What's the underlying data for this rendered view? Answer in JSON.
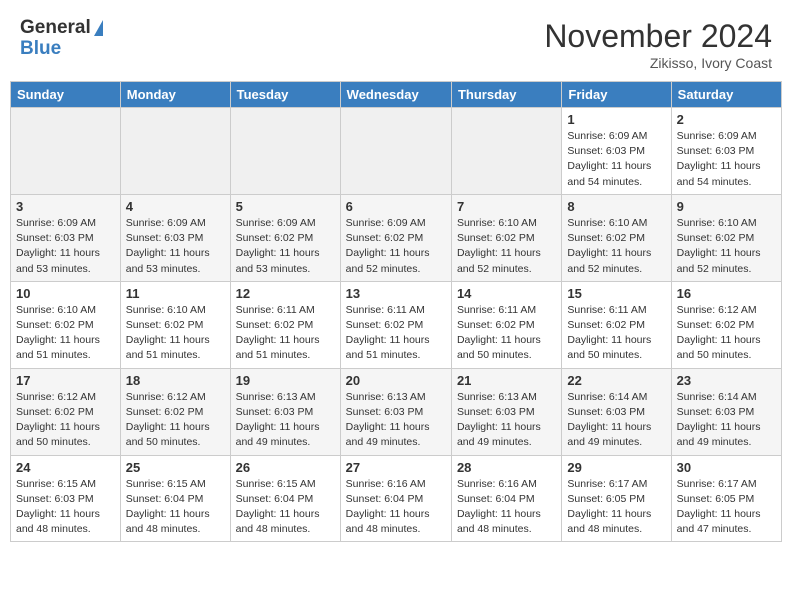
{
  "header": {
    "logo_general": "General",
    "logo_blue": "Blue",
    "month_title": "November 2024",
    "subtitle": "Zikisso, Ivory Coast"
  },
  "weekdays": [
    "Sunday",
    "Monday",
    "Tuesday",
    "Wednesday",
    "Thursday",
    "Friday",
    "Saturday"
  ],
  "weeks": [
    [
      {
        "day": "",
        "info": ""
      },
      {
        "day": "",
        "info": ""
      },
      {
        "day": "",
        "info": ""
      },
      {
        "day": "",
        "info": ""
      },
      {
        "day": "",
        "info": ""
      },
      {
        "day": "1",
        "info": "Sunrise: 6:09 AM\nSunset: 6:03 PM\nDaylight: 11 hours\nand 54 minutes."
      },
      {
        "day": "2",
        "info": "Sunrise: 6:09 AM\nSunset: 6:03 PM\nDaylight: 11 hours\nand 54 minutes."
      }
    ],
    [
      {
        "day": "3",
        "info": "Sunrise: 6:09 AM\nSunset: 6:03 PM\nDaylight: 11 hours\nand 53 minutes."
      },
      {
        "day": "4",
        "info": "Sunrise: 6:09 AM\nSunset: 6:03 PM\nDaylight: 11 hours\nand 53 minutes."
      },
      {
        "day": "5",
        "info": "Sunrise: 6:09 AM\nSunset: 6:02 PM\nDaylight: 11 hours\nand 53 minutes."
      },
      {
        "day": "6",
        "info": "Sunrise: 6:09 AM\nSunset: 6:02 PM\nDaylight: 11 hours\nand 52 minutes."
      },
      {
        "day": "7",
        "info": "Sunrise: 6:10 AM\nSunset: 6:02 PM\nDaylight: 11 hours\nand 52 minutes."
      },
      {
        "day": "8",
        "info": "Sunrise: 6:10 AM\nSunset: 6:02 PM\nDaylight: 11 hours\nand 52 minutes."
      },
      {
        "day": "9",
        "info": "Sunrise: 6:10 AM\nSunset: 6:02 PM\nDaylight: 11 hours\nand 52 minutes."
      }
    ],
    [
      {
        "day": "10",
        "info": "Sunrise: 6:10 AM\nSunset: 6:02 PM\nDaylight: 11 hours\nand 51 minutes."
      },
      {
        "day": "11",
        "info": "Sunrise: 6:10 AM\nSunset: 6:02 PM\nDaylight: 11 hours\nand 51 minutes."
      },
      {
        "day": "12",
        "info": "Sunrise: 6:11 AM\nSunset: 6:02 PM\nDaylight: 11 hours\nand 51 minutes."
      },
      {
        "day": "13",
        "info": "Sunrise: 6:11 AM\nSunset: 6:02 PM\nDaylight: 11 hours\nand 51 minutes."
      },
      {
        "day": "14",
        "info": "Sunrise: 6:11 AM\nSunset: 6:02 PM\nDaylight: 11 hours\nand 50 minutes."
      },
      {
        "day": "15",
        "info": "Sunrise: 6:11 AM\nSunset: 6:02 PM\nDaylight: 11 hours\nand 50 minutes."
      },
      {
        "day": "16",
        "info": "Sunrise: 6:12 AM\nSunset: 6:02 PM\nDaylight: 11 hours\nand 50 minutes."
      }
    ],
    [
      {
        "day": "17",
        "info": "Sunrise: 6:12 AM\nSunset: 6:02 PM\nDaylight: 11 hours\nand 50 minutes."
      },
      {
        "day": "18",
        "info": "Sunrise: 6:12 AM\nSunset: 6:02 PM\nDaylight: 11 hours\nand 50 minutes."
      },
      {
        "day": "19",
        "info": "Sunrise: 6:13 AM\nSunset: 6:03 PM\nDaylight: 11 hours\nand 49 minutes."
      },
      {
        "day": "20",
        "info": "Sunrise: 6:13 AM\nSunset: 6:03 PM\nDaylight: 11 hours\nand 49 minutes."
      },
      {
        "day": "21",
        "info": "Sunrise: 6:13 AM\nSunset: 6:03 PM\nDaylight: 11 hours\nand 49 minutes."
      },
      {
        "day": "22",
        "info": "Sunrise: 6:14 AM\nSunset: 6:03 PM\nDaylight: 11 hours\nand 49 minutes."
      },
      {
        "day": "23",
        "info": "Sunrise: 6:14 AM\nSunset: 6:03 PM\nDaylight: 11 hours\nand 49 minutes."
      }
    ],
    [
      {
        "day": "24",
        "info": "Sunrise: 6:15 AM\nSunset: 6:03 PM\nDaylight: 11 hours\nand 48 minutes."
      },
      {
        "day": "25",
        "info": "Sunrise: 6:15 AM\nSunset: 6:04 PM\nDaylight: 11 hours\nand 48 minutes."
      },
      {
        "day": "26",
        "info": "Sunrise: 6:15 AM\nSunset: 6:04 PM\nDaylight: 11 hours\nand 48 minutes."
      },
      {
        "day": "27",
        "info": "Sunrise: 6:16 AM\nSunset: 6:04 PM\nDaylight: 11 hours\nand 48 minutes."
      },
      {
        "day": "28",
        "info": "Sunrise: 6:16 AM\nSunset: 6:04 PM\nDaylight: 11 hours\nand 48 minutes."
      },
      {
        "day": "29",
        "info": "Sunrise: 6:17 AM\nSunset: 6:05 PM\nDaylight: 11 hours\nand 48 minutes."
      },
      {
        "day": "30",
        "info": "Sunrise: 6:17 AM\nSunset: 6:05 PM\nDaylight: 11 hours\nand 47 minutes."
      }
    ]
  ]
}
